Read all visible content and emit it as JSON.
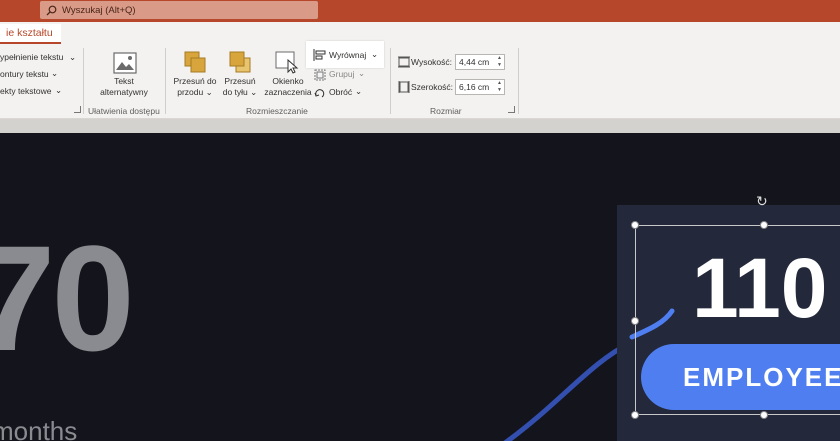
{
  "titlebar": {
    "search_placeholder": "Wyszukaj (Alt+Q)"
  },
  "ribbon": {
    "active_tab": "ie kształtu",
    "shape_styles": {
      "fill": "ypełnienie tekstu",
      "outline": "ontury tekstu",
      "effects": "ekty tekstowe"
    },
    "accessibility": {
      "alt_text_line1": "Tekst",
      "alt_text_line2": "alternatywny",
      "group_label": "Ułatwienia dostępu"
    },
    "arrange": {
      "bring_forward_line1": "Przesuń do",
      "bring_forward_line2": "przodu",
      "send_backward_line1": "Przesuń",
      "send_backward_line2": "do tyłu",
      "selection_pane_line1": "Okienko",
      "selection_pane_line2": "zaznaczenia",
      "align": "Wyrównaj",
      "group": "Grupuj",
      "rotate": "Obróć",
      "group_label": "Rozmieszczanie"
    },
    "size": {
      "height_label": "Wysokość:",
      "height_value": "4,44 cm",
      "width_label": "Szerokość:",
      "width_value": "6,16 cm",
      "group_label": "Rozmiar"
    }
  },
  "slide": {
    "left_number": "70",
    "left_caption": "months",
    "stat_number": "110",
    "stat_label": "EMPLOYEES"
  },
  "colors": {
    "titlebar": "#b7472a",
    "ribbon_bg": "#f3f2f1",
    "slide_bg": "#14151c",
    "card_bg": "#23283a",
    "pill": "#4e7ef0",
    "curve": "#3350b0"
  }
}
